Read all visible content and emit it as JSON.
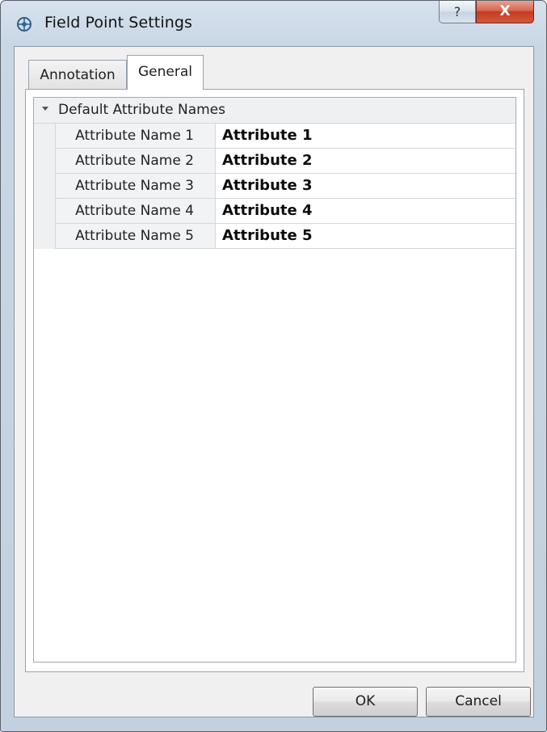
{
  "window": {
    "title": "Field Point Settings",
    "help_label": "?",
    "close_label": "X"
  },
  "tabs": [
    {
      "label": "Annotation",
      "selected": false
    },
    {
      "label": "General",
      "selected": true
    }
  ],
  "property_grid": {
    "category": "Default Attribute Names",
    "rows": [
      {
        "name": "Attribute Name 1",
        "value": "Attribute 1"
      },
      {
        "name": "Attribute Name 2",
        "value": "Attribute 2"
      },
      {
        "name": "Attribute Name 3",
        "value": "Attribute 3"
      },
      {
        "name": "Attribute Name 4",
        "value": "Attribute 4"
      },
      {
        "name": "Attribute Name 5",
        "value": "Attribute 5"
      }
    ]
  },
  "buttons": {
    "ok": "OK",
    "cancel": "Cancel"
  },
  "colors": {
    "close_button": "#c43b22",
    "frame": "#c9d6e4"
  },
  "icons": {
    "app": "field-point-app-icon",
    "expander": "triangle-down-icon"
  }
}
